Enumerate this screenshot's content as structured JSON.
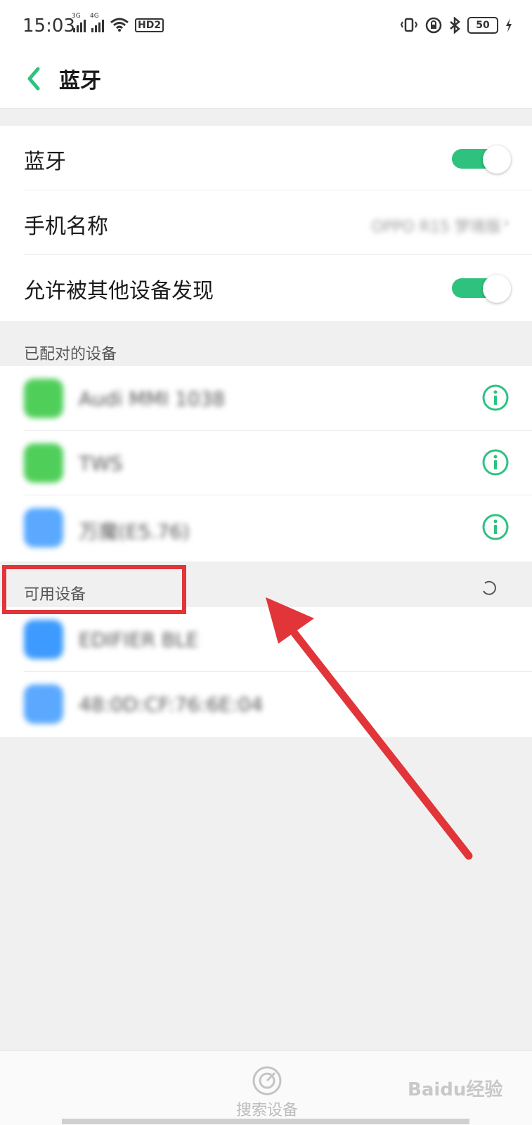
{
  "status_bar": {
    "time": "15:03",
    "signal1_label": "3G",
    "signal2_label": "4G",
    "hd_label": "HD2",
    "battery_level": "50",
    "icons": [
      "signal-3g-icon",
      "signal-4g-icon",
      "wifi-icon",
      "hd-icon",
      "vibrate-icon",
      "lock-rotation-icon",
      "bluetooth-icon",
      "battery-icon",
      "charging-icon"
    ]
  },
  "header": {
    "title": "蓝牙"
  },
  "settings": {
    "bluetooth": {
      "label": "蓝牙",
      "on": true
    },
    "phone_name": {
      "label": "手机名称",
      "value": "OPPO R15 梦境版"
    },
    "discoverable": {
      "label": "允许被其他设备发现",
      "on": true
    }
  },
  "paired": {
    "header": "已配对的设备",
    "devices": [
      {
        "name": "Audi MMI 1038",
        "icon_color": "#4fcf5a"
      },
      {
        "name": "TWS",
        "icon_color": "#4fcf5a"
      },
      {
        "name": "万魔(E5.76)",
        "icon_color": "#5aa9ff"
      }
    ]
  },
  "available": {
    "header": "可用设备",
    "devices": [
      {
        "name": "EDIFIER BLE",
        "icon_color": "#3d9bff"
      },
      {
        "name": "48:0D:CF:76:6E:04",
        "icon_color": "#5aa9ff"
      }
    ]
  },
  "bottom": {
    "search_label": "搜索设备"
  },
  "watermark": "Baidu经验",
  "colors": {
    "accent": "#2ec27e",
    "annotation": "#e1353a"
  }
}
